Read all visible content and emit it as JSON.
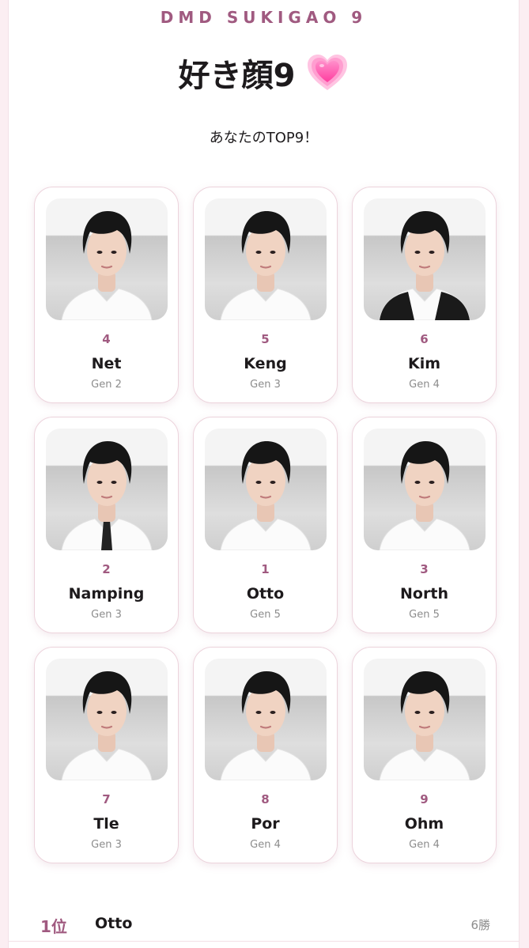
{
  "header": {
    "brand": "DMD SUKIGAO 9",
    "title": "好き顔9",
    "title_icon": "growing-heart-icon",
    "subtitle": "あなたのTOP9！"
  },
  "colors": {
    "accent": "#a05a80",
    "heart": "#ff5fae",
    "card_border": "#ecd3dc",
    "background": "#fbeef2"
  },
  "cards": [
    {
      "rank": "4",
      "name": "Net",
      "gen": "Gen 2",
      "outfit": "white-shirt"
    },
    {
      "rank": "5",
      "name": "Keng",
      "gen": "Gen 3",
      "outfit": "white-shirt"
    },
    {
      "rank": "6",
      "name": "Kim",
      "gen": "Gen 4",
      "outfit": "black-vest"
    },
    {
      "rank": "2",
      "name": "Namping",
      "gen": "Gen 3",
      "outfit": "white-shirt-tie"
    },
    {
      "rank": "1",
      "name": "Otto",
      "gen": "Gen 5",
      "outfit": "white-shirt"
    },
    {
      "rank": "3",
      "name": "North",
      "gen": "Gen 5",
      "outfit": "white-shirt"
    },
    {
      "rank": "7",
      "name": "Tle",
      "gen": "Gen 3",
      "outfit": "white-shirt"
    },
    {
      "rank": "8",
      "name": "Por",
      "gen": "Gen 4",
      "outfit": "white-shirt"
    },
    {
      "rank": "9",
      "name": "Ohm",
      "gen": "Gen 4",
      "outfit": "white-shirt"
    }
  ],
  "results": [
    {
      "rank": "1位",
      "name": "Otto",
      "wins": "6勝"
    }
  ]
}
